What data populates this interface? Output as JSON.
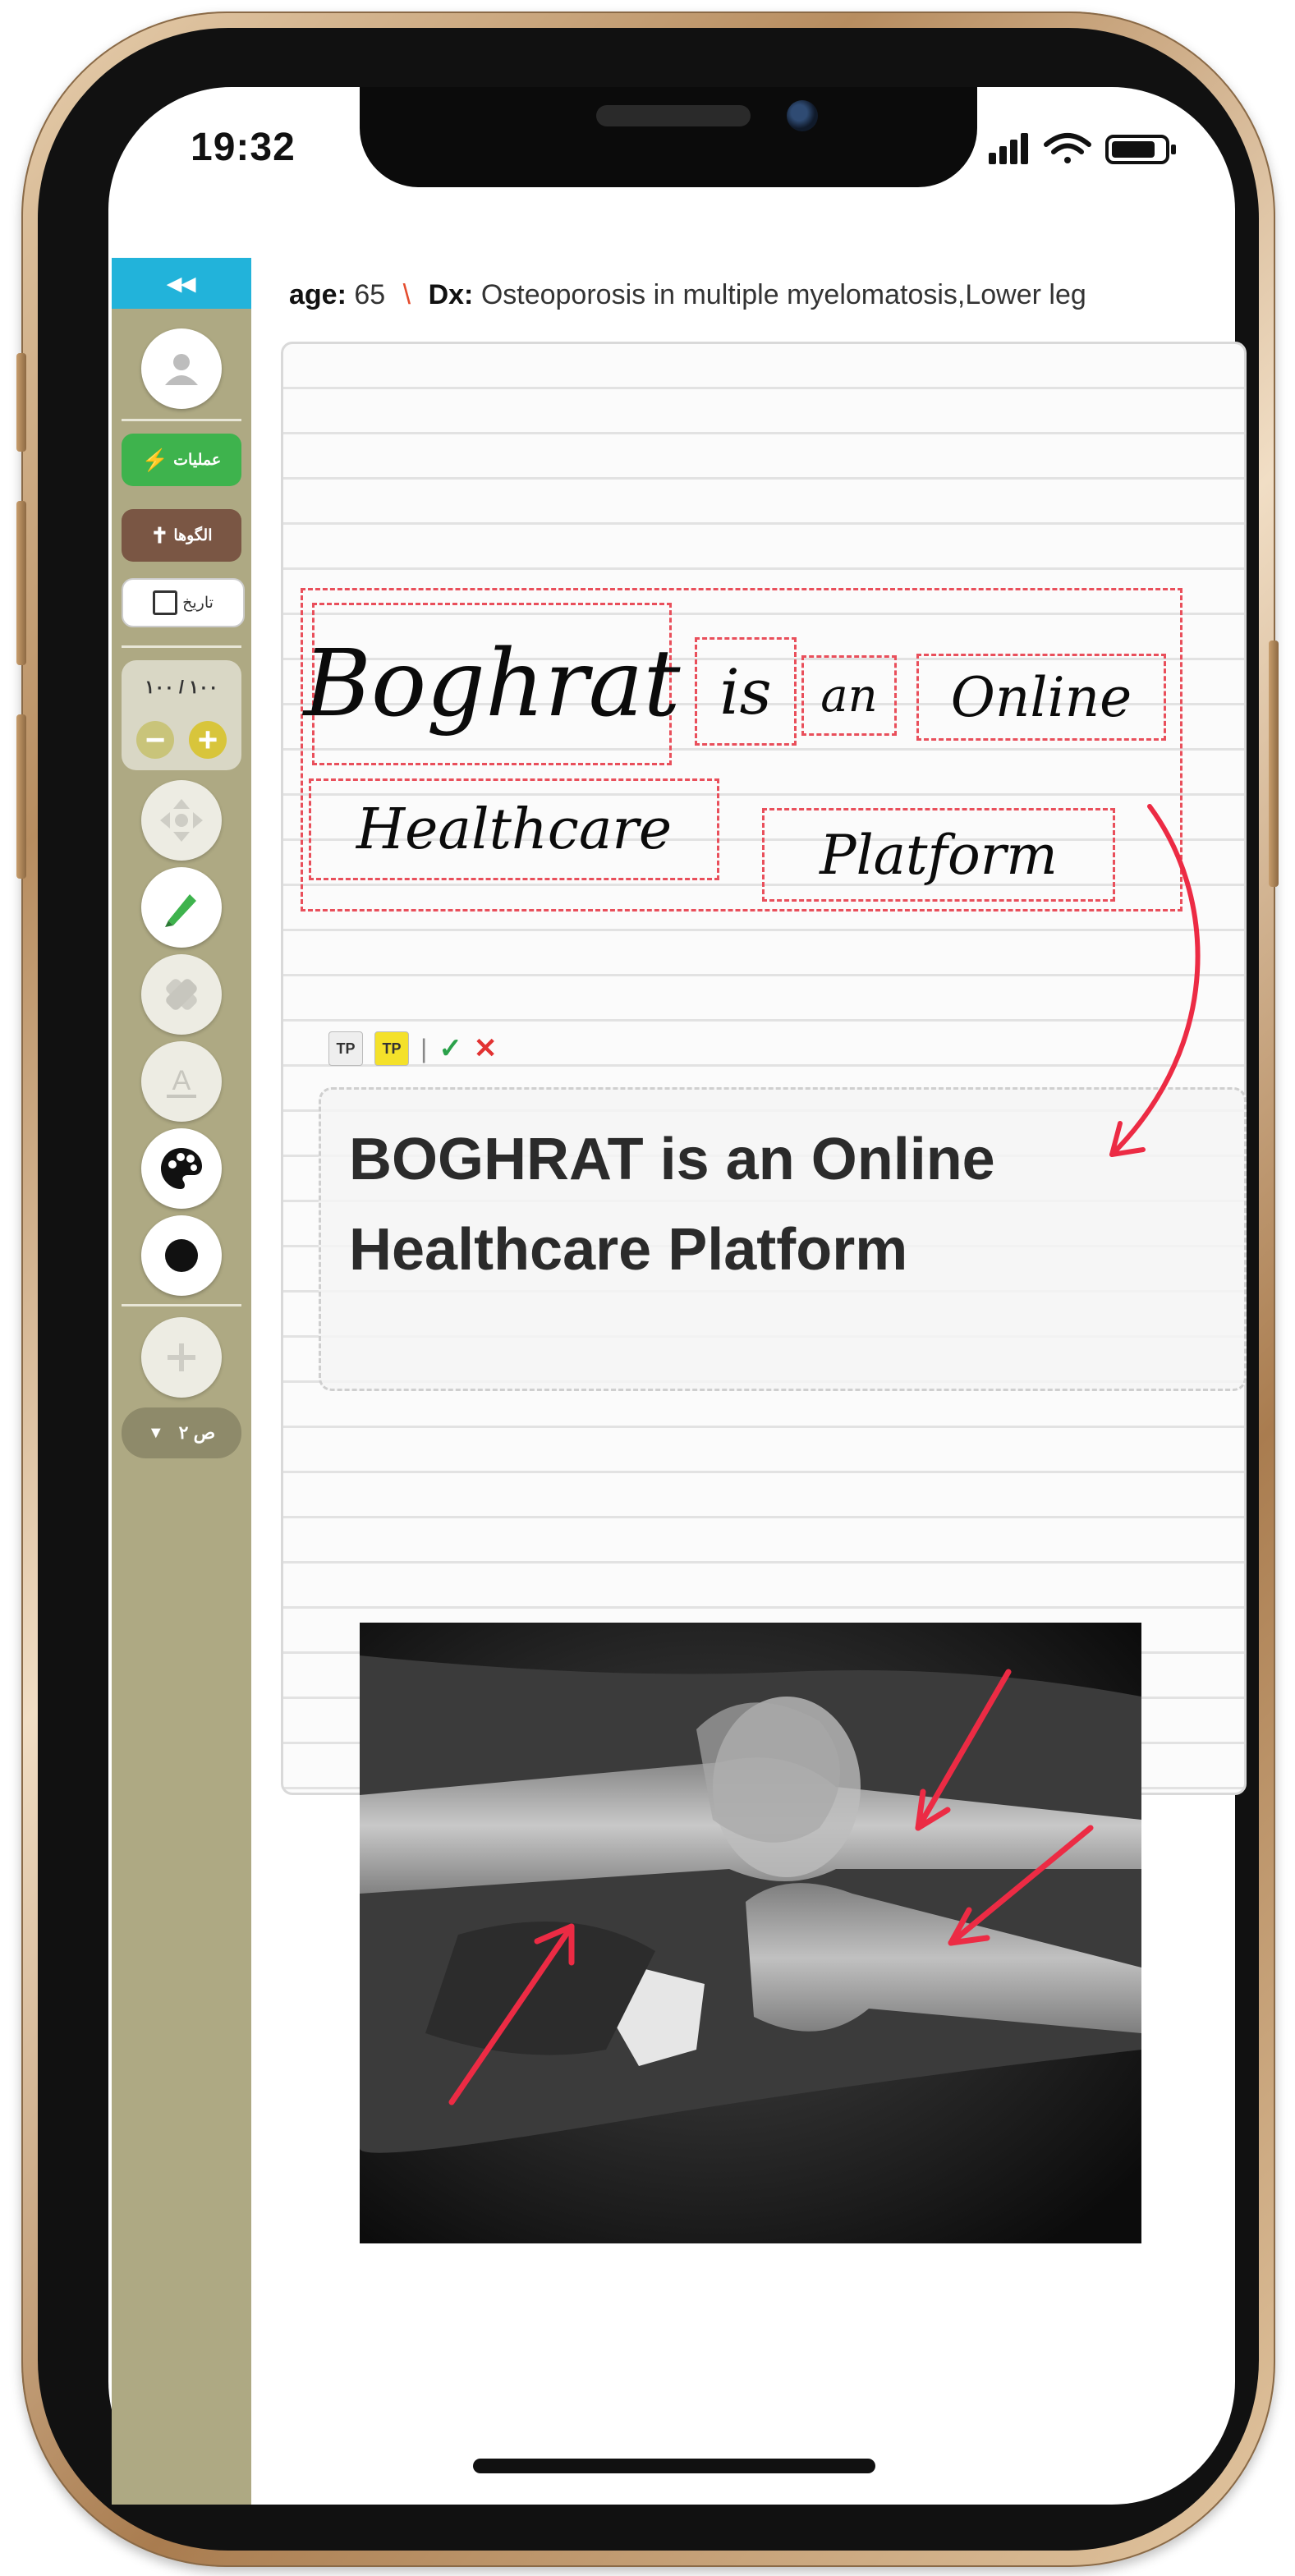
{
  "status_bar": {
    "time": "19:32",
    "icons": [
      "signal-icon",
      "wifi-icon",
      "battery-icon"
    ]
  },
  "sidebar": {
    "collapse_label": "◂◂",
    "operations_label": "عملیات",
    "templates_label": "الگوها",
    "date_label": "تاریخ",
    "zoom_text": "۱۰۰ / ۱۰۰",
    "zoom_minus": "−",
    "zoom_plus": "+",
    "page_label": "ص ۲",
    "tools": [
      "profile-icon",
      "move-icon",
      "pen-icon",
      "eraser-icon",
      "text-icon",
      "palette-icon",
      "stroke-size-icon",
      "add-icon"
    ]
  },
  "header": {
    "age_label": "age:",
    "age_value": "65",
    "separator": "\\",
    "dx_label": "Dx:",
    "dx_value": "Osteoporosis in multiple myelomatosis,Lower leg"
  },
  "handwriting": {
    "words": [
      "Boghrat",
      "is",
      "an",
      "Online",
      "Healthcare",
      "Platform"
    ]
  },
  "recognition_toolbar": {
    "tool1": "TP",
    "tool2": "TP",
    "divider": "|",
    "accept": "✓",
    "reject": "✕"
  },
  "recognized_text": {
    "line1": "BOGHRAT is an Online",
    "line2": "Healthcare Platform"
  },
  "colors": {
    "accent_blue": "#22b3da",
    "operations_green": "#3eb34d",
    "templates_brown": "#7a5644",
    "sidebar_olive": "#aea983",
    "dashed_red": "#e94f5b",
    "annotation_arrow": "#ec2b44"
  }
}
